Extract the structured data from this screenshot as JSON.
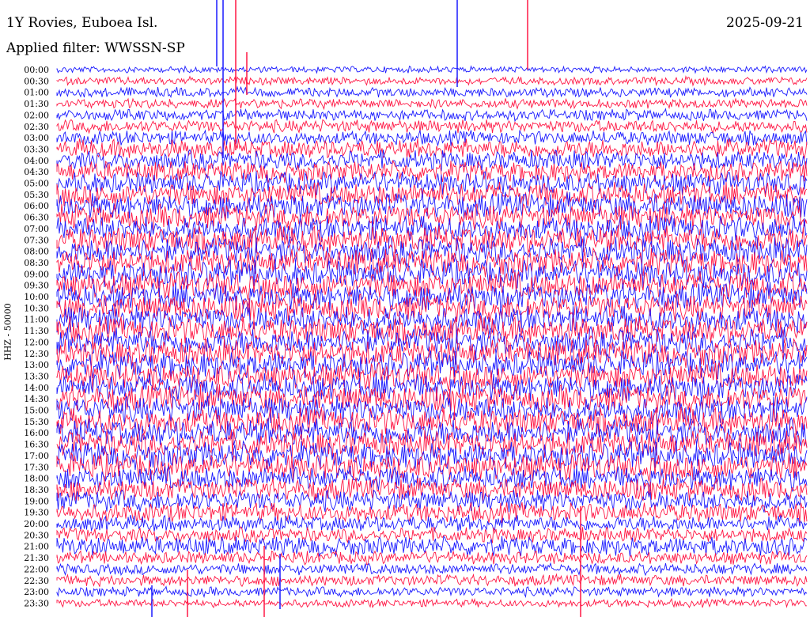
{
  "header": {
    "station": "1Y Rovies, Euboea Isl.",
    "date": "2025-09-21",
    "filter": "Applied filter: WWSSN-SP"
  },
  "chart_data": {
    "type": "line",
    "title": "1Y Rovies, Euboea Isl.",
    "ylabel": "HHZ - 50000",
    "row_labels": [
      "00:00",
      "00:30",
      "01:00",
      "01:30",
      "02:00",
      "02:30",
      "03:00",
      "03:30",
      "04:00",
      "04:30",
      "05:00",
      "05:30",
      "06:00",
      "06:30",
      "07:00",
      "07:30",
      "08:00",
      "08:30",
      "09:00",
      "09:30",
      "10:00",
      "10:30",
      "11:00",
      "11:30",
      "12:00",
      "12:30",
      "13:00",
      "13:30",
      "14:00",
      "14:30",
      "15:00",
      "15:30",
      "16:00",
      "16:30",
      "17:00",
      "17:30",
      "18:00",
      "18:30",
      "19:00",
      "19:30",
      "20:00",
      "20:30",
      "21:00",
      "21:30",
      "22:00",
      "22:30",
      "23:00",
      "23:30"
    ],
    "row_amplitude": [
      4,
      5,
      6,
      6,
      7,
      8,
      9,
      12,
      12,
      13,
      14,
      15,
      16,
      16,
      16,
      17,
      17,
      17,
      17,
      17,
      17,
      17,
      17,
      17,
      17,
      17,
      17,
      17,
      17,
      17,
      17,
      17,
      17,
      17,
      17,
      17,
      15,
      14,
      13,
      12,
      10,
      9,
      12,
      8,
      7,
      7,
      6,
      5
    ],
    "series_colors": [
      "#1a1aff",
      "#ff1744"
    ],
    "grid": false
  }
}
